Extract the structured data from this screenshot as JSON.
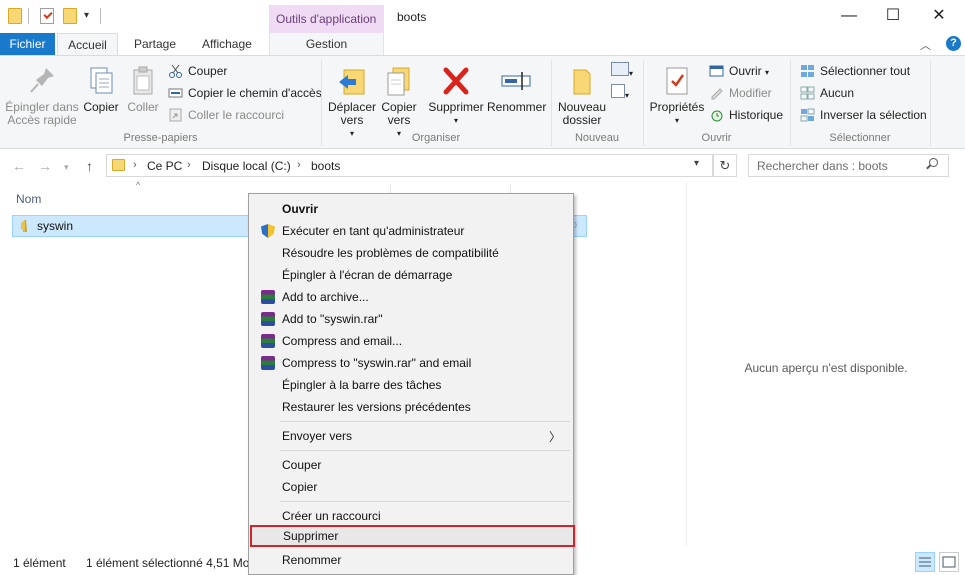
{
  "window": {
    "title": "boots",
    "tools_tab": "Outils d'application",
    "minimize": "—",
    "maximize": "☐",
    "close": "✕"
  },
  "ribbon_tabs": {
    "file": "Fichier",
    "home": "Accueil",
    "share": "Partage",
    "view": "Affichage",
    "manage": "Gestion",
    "help": "?"
  },
  "ribbon": {
    "clipboard": {
      "label": "Presse-papiers",
      "pin": "Épingler dans Accès rapide",
      "copy": "Copier",
      "paste": "Coller",
      "cut": "Couper",
      "copy_path": "Copier le chemin d'accès",
      "paste_shortcut": "Coller le raccourci"
    },
    "organize": {
      "label": "Organiser",
      "move_to": "Déplacer vers",
      "copy_to": "Copier vers",
      "delete": "Supprimer",
      "rename": "Renommer"
    },
    "new": {
      "label": "Nouveau",
      "new_folder": "Nouveau dossier"
    },
    "open": {
      "label": "Ouvrir",
      "properties": "Propriétés",
      "open": "Ouvrir",
      "edit": "Modifier",
      "history": "Historique"
    },
    "select": {
      "label": "Sélectionner",
      "select_all": "Sélectionner tout",
      "select_none": "Aucun",
      "invert": "Inverser la sélection"
    }
  },
  "address": {
    "parts": [
      "Ce PC",
      "Disque local (C:)",
      "boots"
    ],
    "search_placeholder": "Rechercher dans : boots"
  },
  "filelist": {
    "column_name": "Nom",
    "files": [
      {
        "name": "syswin",
        "selected": true
      }
    ],
    "preview_text": "Aucun aperçu n'est disponible."
  },
  "context_menu": {
    "items": [
      {
        "label": "Ouvrir",
        "bold": true
      },
      {
        "label": "Exécuter en tant qu'administrateur",
        "icon": "shield-icon"
      },
      {
        "label": "Résoudre les problèmes de compatibilité"
      },
      {
        "label": "Épingler à l'écran de démarrage"
      },
      {
        "label": "Add to archive...",
        "icon": "winrar-icon"
      },
      {
        "label": "Add to \"syswin.rar\"",
        "icon": "winrar-icon"
      },
      {
        "label": "Compress and email...",
        "icon": "winrar-icon"
      },
      {
        "label": "Compress to \"syswin.rar\" and email",
        "icon": "winrar-icon"
      },
      {
        "label": "Épingler à la barre des tâches"
      },
      {
        "label": "Restaurer les versions précédentes"
      },
      {
        "label": "Envoyer vers",
        "submenu": true
      },
      {
        "label": "Couper"
      },
      {
        "label": "Copier"
      },
      {
        "label": "Créer un raccourci"
      },
      {
        "label": "Supprimer",
        "highlighted": true
      },
      {
        "label": "Renommer"
      }
    ]
  },
  "status": {
    "count": "1 élément",
    "selected": "1 élément sélectionné  4,51 Mo"
  },
  "colors": {
    "accent": "#1979ca",
    "selection": "#cce8ff",
    "highlight_border": "#d2232a",
    "tools_tab": "#f0dbf5"
  }
}
